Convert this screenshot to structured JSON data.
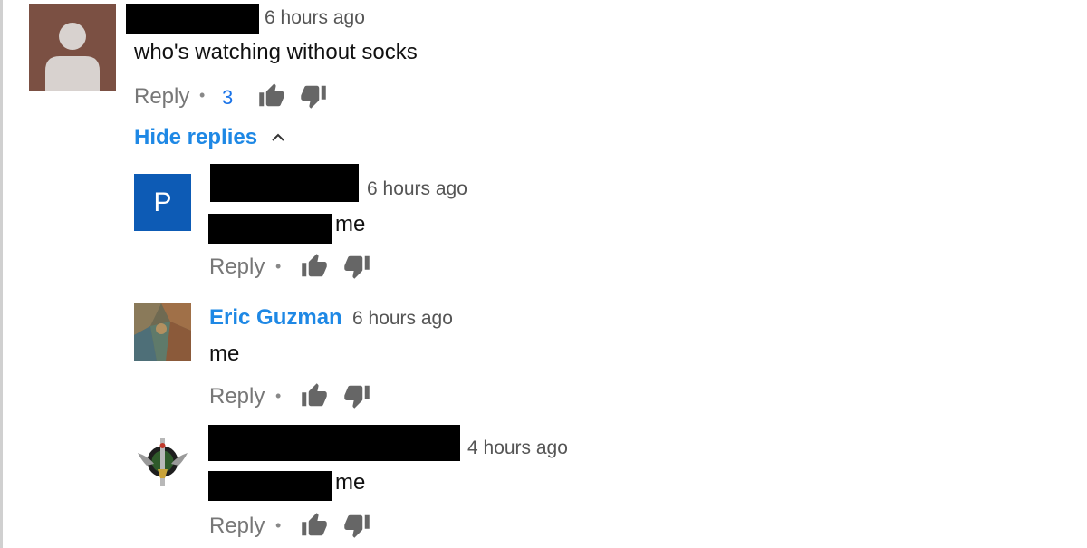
{
  "comment": {
    "timestamp": "6 hours ago",
    "text": "who's watching without socks",
    "reply_label": "Reply",
    "like_count": "3",
    "hide_replies_label": "Hide replies"
  },
  "replies": [
    {
      "avatar_letter": "P",
      "timestamp": "6 hours ago",
      "text": "me",
      "reply_label": "Reply"
    },
    {
      "author": "Eric Guzman",
      "timestamp": "6 hours ago",
      "text": "me",
      "reply_label": "Reply"
    },
    {
      "timestamp": "4 hours ago",
      "text": "me",
      "reply_label": "Reply"
    }
  ],
  "icons": {
    "like": "thumbs-up-icon",
    "dislike": "thumbs-down-icon",
    "collapse": "chevron-up-icon"
  },
  "colors": {
    "link": "#1e88e5",
    "avatar_p": "#0d5bb5",
    "avatar_default": "#7b5043"
  }
}
